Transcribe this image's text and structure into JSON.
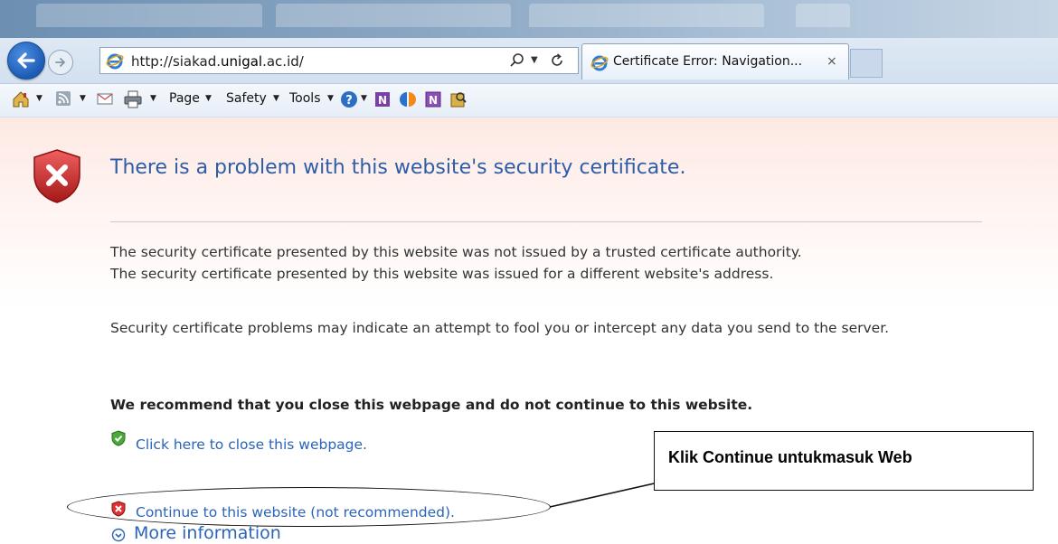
{
  "browser": {
    "address_url_prefix": "http://siakad.",
    "address_url_domain": "unigal",
    "address_url_suffix": ".ac.id/",
    "tab_title": "Certificate Error: Navigation...",
    "tab_close": "×",
    "toolbar": {
      "page_label": "Page",
      "safety_label": "Safety",
      "tools_label": "Tools"
    }
  },
  "error_page": {
    "title": "There is a problem with this website's security certificate.",
    "line1": "The security certificate presented by this website was not issued by a trusted certificate authority.",
    "line2": "The security certificate presented by this website was issued for a different website's address.",
    "line3": "Security certificate problems may indicate an attempt to fool you or intercept any data you send to the server.",
    "recommendation": "We recommend that you close this webpage and do not continue to this website.",
    "close_link": "Click here to close this webpage.",
    "continue_link": "Continue to this website (not recommended).",
    "more_info": "More information"
  },
  "annotation": {
    "callout_text": "Klik Continue untukmasuk Web"
  }
}
